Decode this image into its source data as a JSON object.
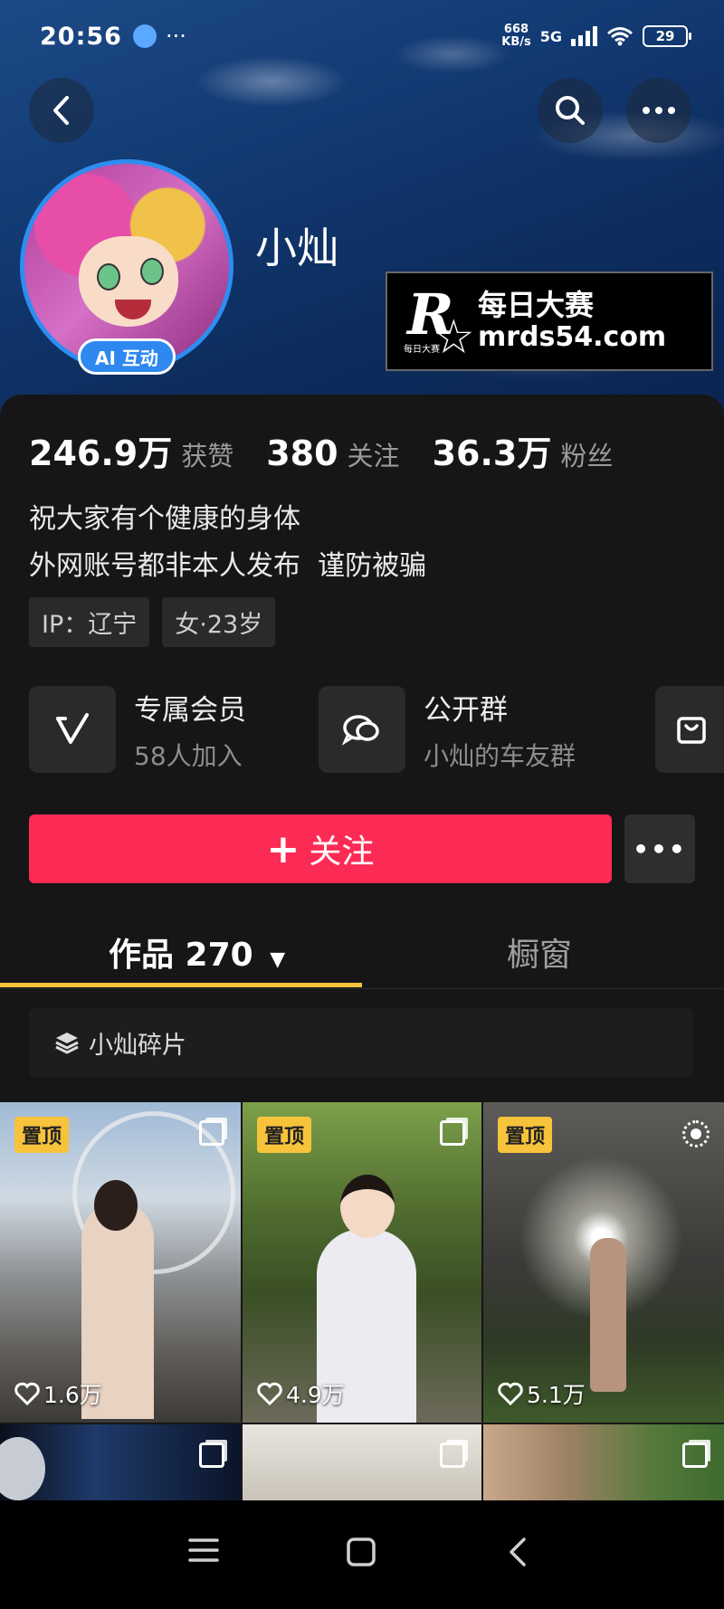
{
  "status_bar": {
    "time": "20:56",
    "more": "···",
    "net_speed_top": "668",
    "net_speed_unit": "KB/s",
    "signal_label": "5G",
    "battery": "29"
  },
  "profile": {
    "name": "小灿",
    "ai_badge": "AI 互动",
    "stats": [
      {
        "value": "246.9万",
        "label": "获赞"
      },
      {
        "value": "380",
        "label": "关注"
      },
      {
        "value": "36.3万",
        "label": "粉丝"
      }
    ],
    "bio_lines": [
      "祝大家有个健康的身体",
      "外网账号都非本人发布  谨防被骗"
    ],
    "tags": [
      "IP：辽宁",
      "女·23岁"
    ]
  },
  "watermark": {
    "letter": "R",
    "cn": "每日大赛",
    "url": "mrds54.com",
    "tiny": "每日大赛"
  },
  "features": [
    {
      "title": "专属会员",
      "subtitle": "58人加入",
      "icon": "vip-v-icon"
    },
    {
      "title": "公开群",
      "subtitle": "小灿的车友群",
      "icon": "chat-bubble-icon"
    }
  ],
  "actions": {
    "follow_label": "关注",
    "follow_plus": "+",
    "more_label": "•••"
  },
  "tabs": {
    "works_label": "作品 270",
    "works_caret": "▼",
    "shop_label": "橱窗"
  },
  "collection": {
    "label": "小灿碎片",
    "icon": "layers-icon"
  },
  "grid": {
    "pin_label": "置顶",
    "posts": [
      {
        "likes": "1.6万",
        "pinned": true
      },
      {
        "likes": "4.9万",
        "pinned": true
      },
      {
        "likes": "5.1万",
        "pinned": true
      }
    ]
  },
  "colors": {
    "accent_red": "#fc2b55",
    "accent_yellow": "#f6c33b",
    "ring_blue": "#2e8df0"
  }
}
